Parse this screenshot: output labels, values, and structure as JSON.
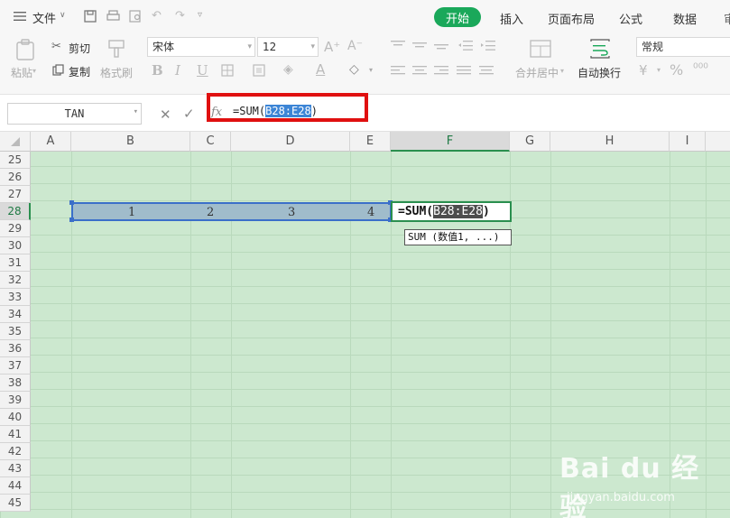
{
  "menu": {
    "file_label": "文件",
    "tabs": [
      "开始",
      "插入",
      "页面布局",
      "公式",
      "数据"
    ],
    "active_tab": "开始"
  },
  "ribbon": {
    "paste_label": "粘贴",
    "cut_label": "剪切",
    "copy_label": "复制",
    "format_painter_label": "格式刷",
    "font_name": "宋体",
    "font_size": "12",
    "number_format": "常规",
    "merge_label": "合并居中",
    "wrap_label": "自动换行"
  },
  "formula_bar": {
    "name_box": "TAN",
    "fx": "fx",
    "prefix": "=SUM(",
    "range": "B28:E28",
    "suffix": ")"
  },
  "sheet": {
    "columns": [
      "A",
      "B",
      "C",
      "D",
      "E",
      "F",
      "G",
      "H",
      "I"
    ],
    "rows": [
      "25",
      "26",
      "27",
      "28",
      "29",
      "30",
      "31",
      "32",
      "33",
      "34",
      "35",
      "36",
      "37",
      "38",
      "39",
      "40",
      "41",
      "42",
      "43",
      "44",
      "45"
    ],
    "selected_column": "F",
    "selected_row": "28",
    "range_values": [
      "1",
      "2",
      "3",
      "4"
    ],
    "cell_formula_prefix": "=SUM(",
    "cell_formula_range": "B28:E28",
    "cell_formula_suffix": ")",
    "tooltip": "SUM (数值1, ...)"
  },
  "watermark": {
    "logo": "Bai du 经验",
    "url": "jingyan.baidu.com"
  },
  "colors": {
    "accent": "#1aa85a",
    "sheet_bg": "#cce8cf",
    "range_border": "#3b6fc9",
    "annotation": "#e01010"
  }
}
